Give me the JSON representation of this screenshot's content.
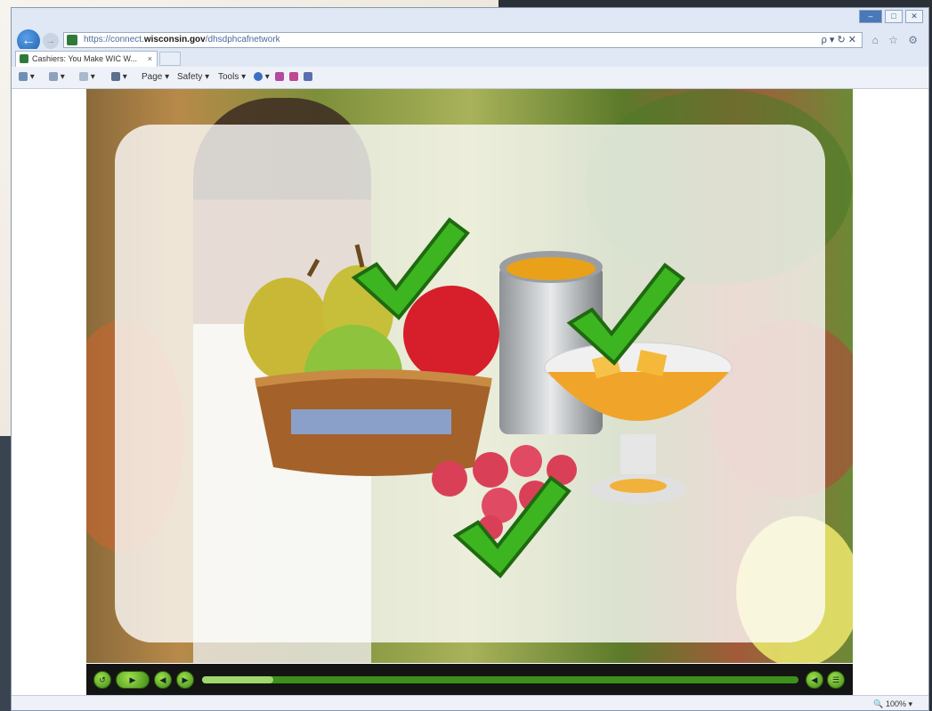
{
  "browser": {
    "address_url_prefix": "https://connect.",
    "address_url_domain": "wisconsin.gov",
    "address_url_suffix": "/dhsdphcafnetwork",
    "address_actions": "ρ ▾ ↻ ✕",
    "tab_title": "Cashiers: You Make WIC W...",
    "tab_close": "×",
    "toolbar_right_icons": "⌂ ☆ ⚙"
  },
  "command_bar": {
    "page_label": "Page ▾",
    "safety_label": "Safety ▾",
    "tools_label": "Tools ▾"
  },
  "player": {
    "progress_fraction": 0.12
  },
  "status": {
    "zoom_label": "100%"
  },
  "colors": {
    "accent_green": "#3d8a16",
    "checkmark_green": "#37b21c"
  },
  "icons": [
    "back-arrow-icon",
    "forward-arrow-icon",
    "site-icon",
    "home-icon",
    "star-icon",
    "gear-icon",
    "print-icon",
    "checkmark-icon"
  ]
}
